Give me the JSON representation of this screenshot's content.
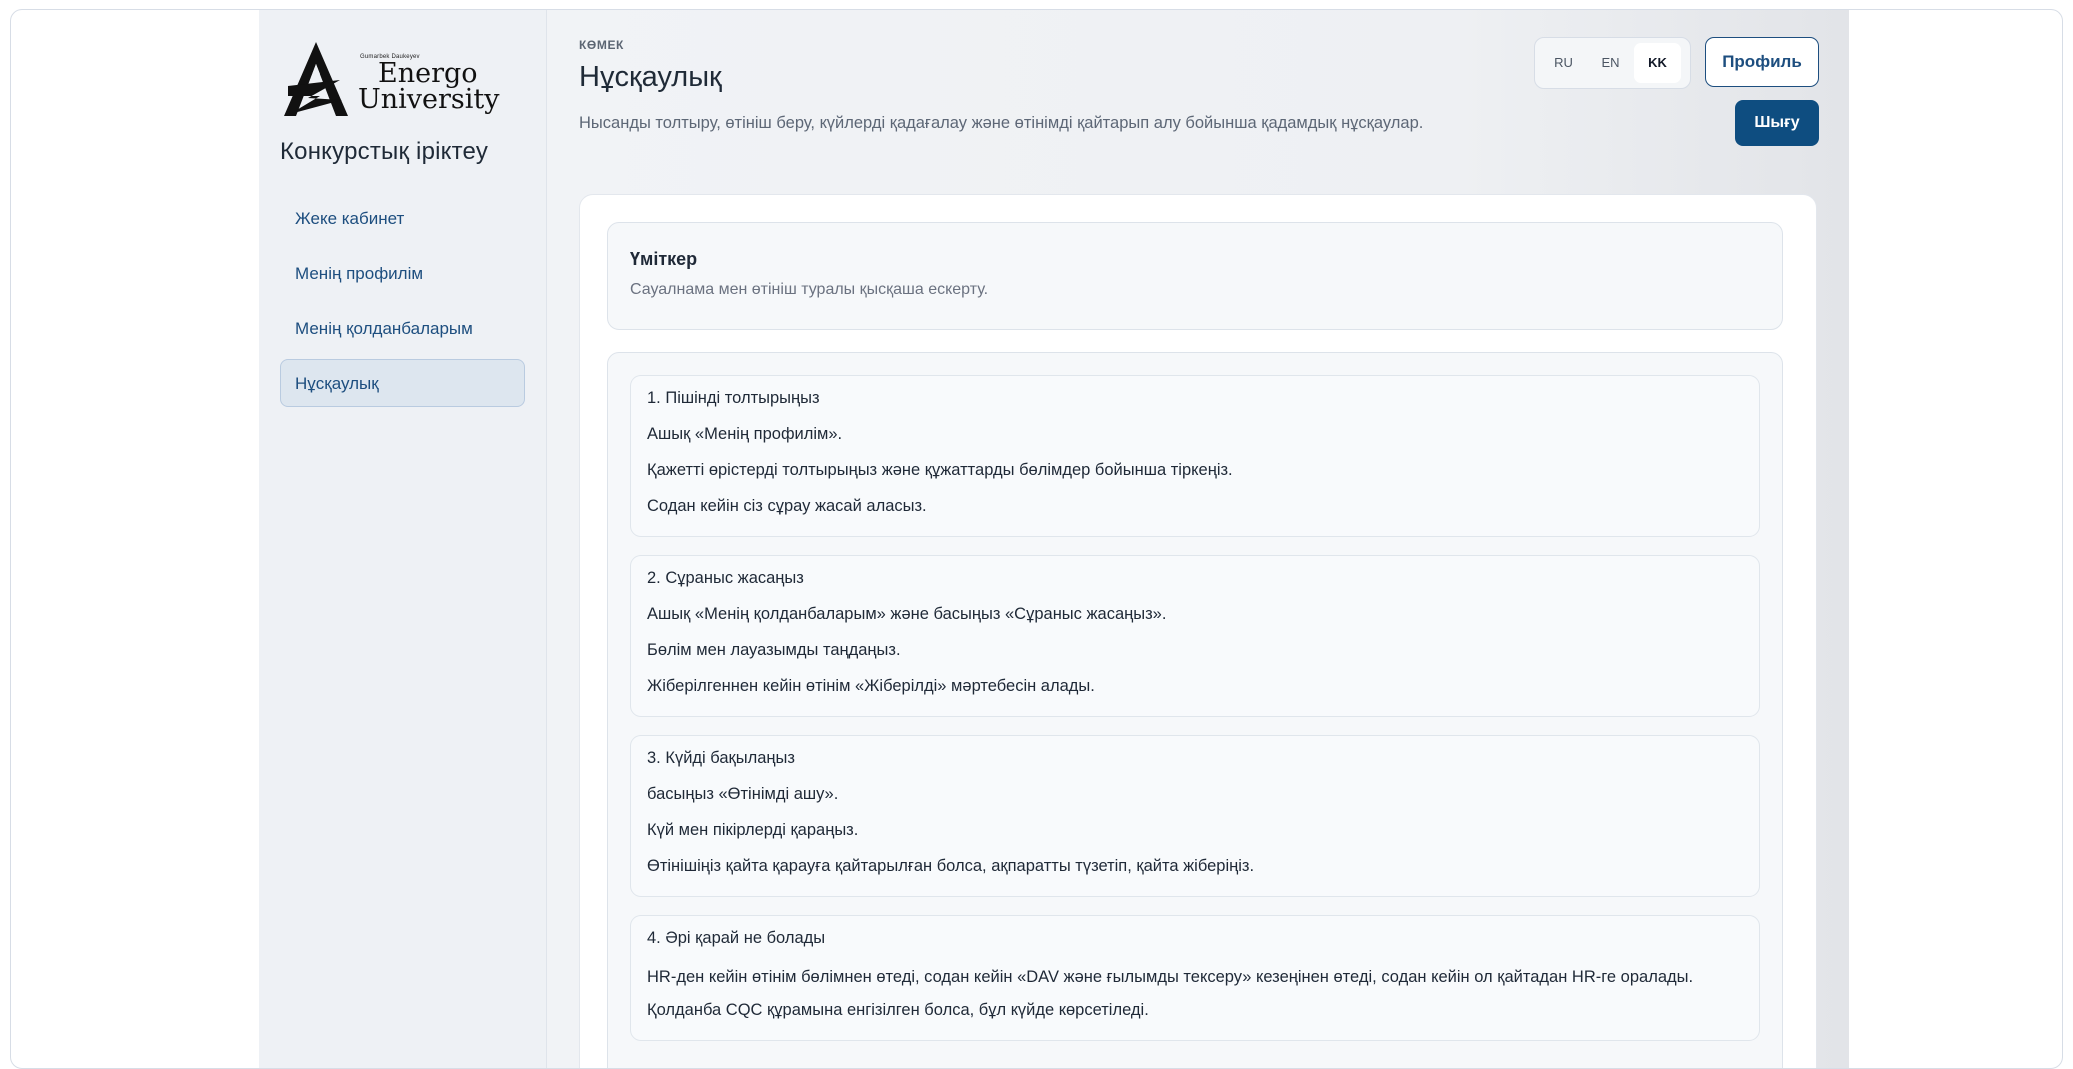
{
  "logo": {
    "small_text": "Gumarbek Daukeyev",
    "line1": "Energo",
    "line2": "University"
  },
  "sidebar": {
    "title": "Конкурстық іріктеу",
    "items": [
      {
        "label": "Жеке кабинет"
      },
      {
        "label": "Менің профилім"
      },
      {
        "label": "Менің қолданбаларым"
      },
      {
        "label": "Нұсқаулық",
        "active": true
      }
    ]
  },
  "header": {
    "eyebrow": "КӨМЕК",
    "title": "Нұсқаулық",
    "description": "Нысанды толтыру, өтініш беру, күйлерді қадағалау және өтінімді қайтарып алу бойынша қадамдық нұсқаулар."
  },
  "languages": [
    {
      "label": "RU"
    },
    {
      "label": "EN"
    },
    {
      "label": "KK",
      "active": true
    }
  ],
  "buttons": {
    "profile": "Профиль",
    "logout": "Шығу"
  },
  "note": {
    "title": "Үміткер",
    "text": "Сауалнама мен өтініш туралы қысқаша ескерту."
  },
  "steps": [
    {
      "title": "1. Пішінді толтырыңыз",
      "lines": [
        "Ашық «Менің профилім».",
        "Қажетті өрістерді толтырыңыз және құжаттарды бөлімдер бойынша тіркеңіз.",
        "Содан кейін сіз сұрау жасай аласыз."
      ]
    },
    {
      "title": "2. Сұраныс жасаңыз",
      "lines": [
        "Ашық «Менің қолданбаларым» және басыңыз «Сұраныс жасаңыз».",
        "Бөлім мен лауазымды таңдаңыз.",
        "Жіберілгеннен кейін өтінім «Жіберілді» мәртебесін алады."
      ]
    },
    {
      "title": "3. Күйді бақылаңыз",
      "lines": [
        "басыңыз «Өтінімді ашу».",
        "Күй мен пікірлерді қараңыз.",
        "Өтінішіңіз қайта қарауға қайтарылған болса, ақпаратты түзетіп, қайта жіберіңіз."
      ]
    },
    {
      "title": "4. Әрі қарай не болады",
      "lines": [
        "HR-ден кейін өтінім бөлімнен өтеді, содан кейін «DAV және ғылымды тексеру» кезеңінен өтеді, содан кейін ол қайтадан HR-ге оралады.",
        "Қолданба CQC құрамына енгізілген болса, бұл күйде көрсетіледі."
      ]
    }
  ]
}
